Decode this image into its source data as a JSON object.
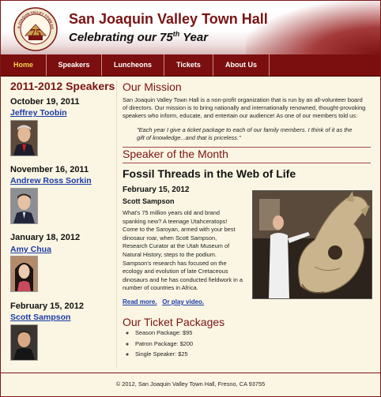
{
  "header": {
    "title": "San Joaquin Valley Town Hall",
    "subtitle_prefix": "Celebrating our 75",
    "subtitle_sup": "th",
    "subtitle_suffix": " Year",
    "logo_text": "SAN JOAQUIN VALLEY TOWN HALL",
    "logo_number": "75",
    "colors": {
      "brand": "#7b0e0e",
      "nav_active": "#f5d24a"
    }
  },
  "nav": {
    "items": [
      {
        "label": "Home",
        "active": true
      },
      {
        "label": "Speakers"
      },
      {
        "label": "Luncheons"
      },
      {
        "label": "Tickets"
      },
      {
        "label": "About Us"
      }
    ]
  },
  "sidebar": {
    "heading": "2011-2012 Speakers",
    "speakers": [
      {
        "date": "October 19, 2011",
        "name": "Jeffrey Toobin"
      },
      {
        "date": "November 16, 2011",
        "name": "Andrew Ross Sorkin"
      },
      {
        "date": "January 18, 2012",
        "name": "Amy Chua"
      },
      {
        "date": "February 15, 2012",
        "name": "Scott Sampson"
      }
    ]
  },
  "mission": {
    "heading": "Our Mission",
    "lines": [
      "San Joaquin Valley Town Hall is a non-profit organization that is run by an all-volunteer board",
      "of directors. Our mission is to bring nationally and internationally renowned, thought-provoking",
      "speakers who inform, educate, and entertain our audience! As one of our members told us:"
    ],
    "quote_lines": [
      "\"Each year I give a ticket package to each of our family members. I think of it as the",
      "gift of knowledge...and that is priceless.\""
    ]
  },
  "speaker_of_month": {
    "heading": "Speaker of the Month",
    "talk_title": "Fossil Threads in the Web of Life",
    "date": "February 15, 2012",
    "name": "Scott Sampson",
    "body_lines": [
      "What's 75 million years old and brand",
      "spanking new? A teenage Utahceratops!",
      "Come to the Saroyan, armed with your best",
      "dinosaur roar, when Scott Sampson,",
      "Research Curator at the Utah Museum of",
      "Natural History, steps to the podium.",
      "Sampson's research has focused on the",
      "ecology and evolution of late Cretaceous",
      "dinosaurs and he has conducted fieldwork in a",
      "number of countries in Africa."
    ],
    "read_more": "Read more.",
    "play_video": "Or play video."
  },
  "tickets": {
    "heading": "Our Ticket Packages",
    "items": [
      "Season Package: $95",
      "Patron Package: $200",
      "Single Speaker: $25"
    ]
  },
  "footer": {
    "text": "© 2012, San Joaquin Valley Town Hall, Fresno, CA 93755"
  }
}
